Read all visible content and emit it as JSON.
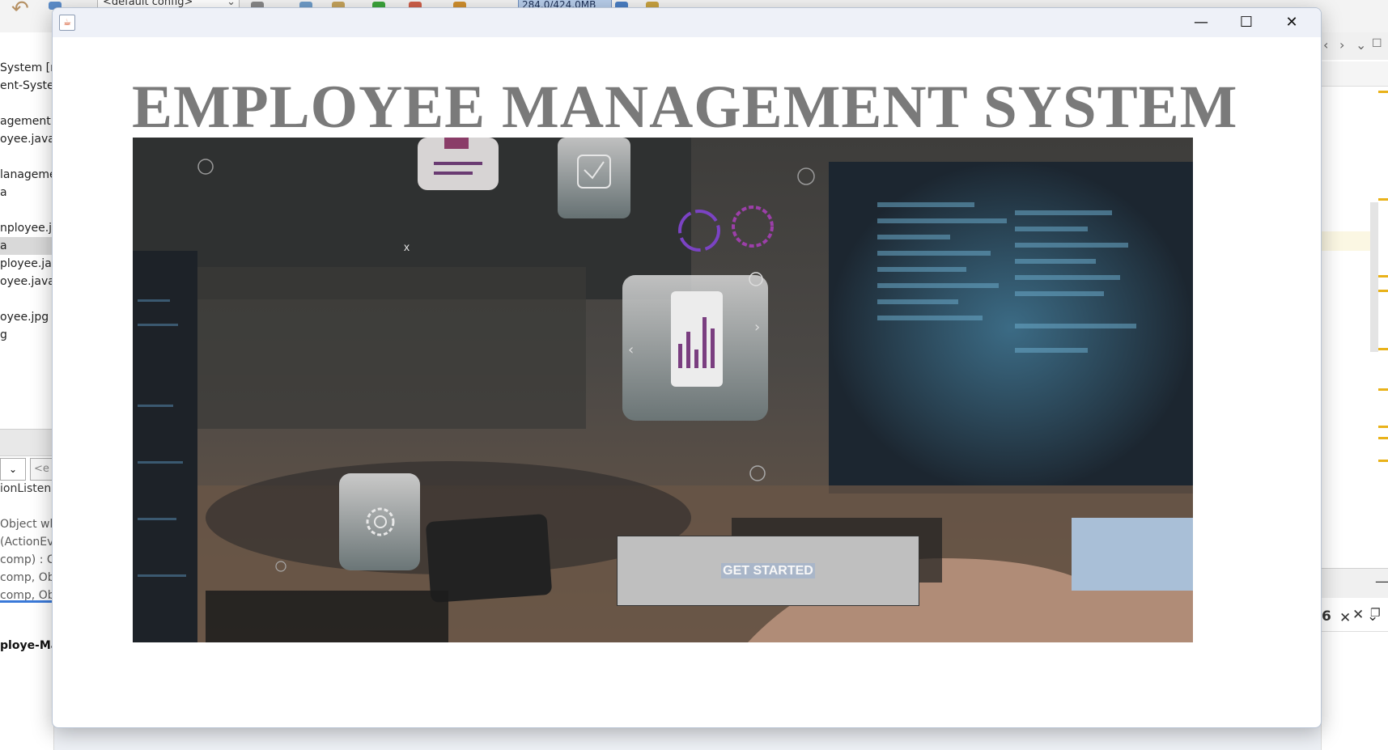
{
  "ide": {
    "config_combo": "<default config>",
    "memory": "284.0/424.0MB",
    "project_tree": [
      "System [m",
      "ent-Systen",
      "",
      "agement.s",
      "oyee.java",
      "",
      "lanageme",
      "a",
      "",
      "nployee.ja",
      "a",
      "ployee.jav",
      "oyee.java",
      "",
      "oyee.jpg",
      "g"
    ],
    "left_field_placeholder": "<e",
    "listener_line": "ionListene",
    "outline": [
      "Object wh",
      "(ActionEve",
      "comp) : Co",
      "comp, Ob",
      "comp, Ob"
    ],
    "editor_tab": "ploye-Ma",
    "right_tab_suffix": "6"
  },
  "window": {
    "minimize": "—",
    "maximize": "☐",
    "close": "✕"
  },
  "app": {
    "title": "EMPLOYEE MANAGEMENT SYSTEM",
    "button_label": "GET STARTED"
  }
}
